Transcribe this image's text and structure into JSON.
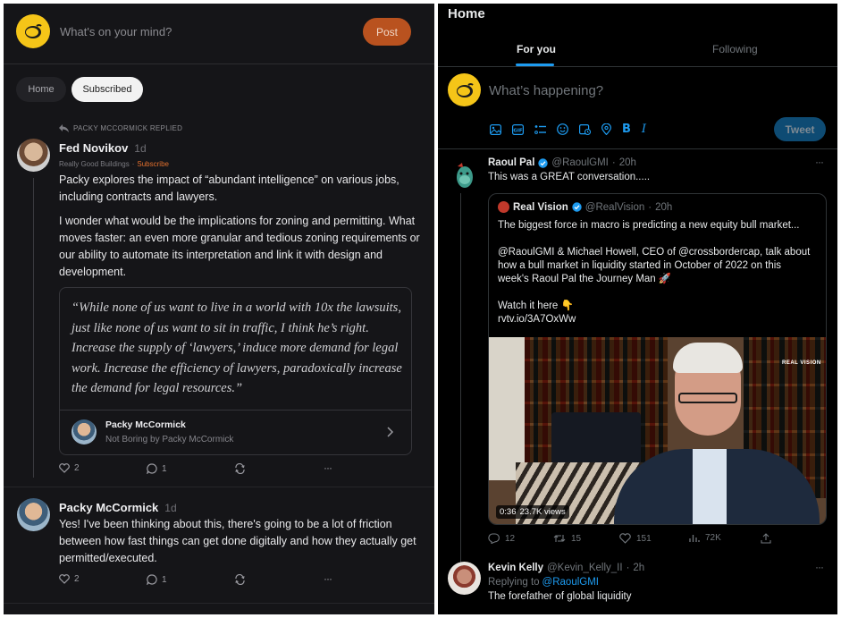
{
  "left": {
    "composer": {
      "placeholder": "What's on your mind?",
      "post_label": "Post"
    },
    "tabs": [
      {
        "label": "Home"
      },
      {
        "label": "Subscribed"
      }
    ],
    "replied_label": "PACKY MCCORMICK REPLIED",
    "comment1": {
      "author": "Fed Novikov",
      "time": "1d",
      "publication": "Really Good Buildings",
      "dot": "·",
      "subscribe": "Subscribe",
      "para1_line1": "Packy explores the impact of “abundant intelligence” on various jobs,",
      "para1_line2": "including contracts and lawyers.",
      "para2_line1": "I wonder what would be the implications for zoning and permitting. What",
      "para2_line2": "moves faster: an even more granular and tedious zoning requirements or",
      "para2_line3": "our ability to automate its interpretation and link it with design and",
      "para2_line4": "development.",
      "quote_line1": "“While none of us want to live in a world with 10x the lawsuits,",
      "quote_line2": "just like none of us want to sit in traffic, I think he’s right.",
      "quote_line3": "Increase the supply of ‘lawyers,’ induce more demand for legal",
      "quote_line4": "work. Increase the efficiency of lawyers, paradoxically increase",
      "quote_line5": "the demand for legal resources.”",
      "source_name": "Packy McCormick",
      "source_pub": "Not Boring by Packy McCormick",
      "likes": "2",
      "comments": "1"
    },
    "comment2": {
      "author": "Packy McCormick",
      "time": "1d",
      "line1": "Yes! I've been thinking about this, there's going to be a lot of friction",
      "line2": "between how fast things can get done digitally and how they actually get",
      "line3": "permitted/executed.",
      "likes": "2",
      "comments": "1"
    },
    "more": "···"
  },
  "right": {
    "title": "Home",
    "tabs": [
      {
        "label": "For you"
      },
      {
        "label": "Following"
      }
    ],
    "composer": {
      "placeholder": "What’s happening?",
      "tweet_label": "Tweet"
    },
    "tweet1": {
      "name": "Raoul Pal",
      "handle": "@RaoulGMI",
      "dot": "·",
      "time": "20h",
      "text": "This was a GREAT conversation.....",
      "more": "···",
      "quoted": {
        "name": "Real Vision",
        "handle": "@RealVision",
        "dot": "·",
        "time": "20h",
        "line1": "The biggest force in macro is predicting a new equity bull market...",
        "line2": "@RaoulGMI & Michael Howell, CEO of @crossbordercap, talk about",
        "line3": "how a bull market in liquidity started in October of 2022 on this",
        "line4": "week's Raoul Pal the Journey Man 🚀",
        "line5": "Watch it here 👇",
        "link": "rvtv.io/3A7OxWw",
        "video_duration": "0:36",
        "video_views": "23.7K views",
        "video_watermark": "REAL VISION"
      },
      "replies": "12",
      "retweets": "15",
      "likes": "151",
      "views": "72K"
    },
    "tweet2": {
      "name": "Kevin Kelly",
      "handle": "@Kevin_Kelly_II",
      "dot": "·",
      "time": "2h",
      "replying_prefix": "Replying to",
      "replying_to": "@RaoulGMI",
      "text": "The forefather of global liquidity",
      "more": "···"
    }
  }
}
